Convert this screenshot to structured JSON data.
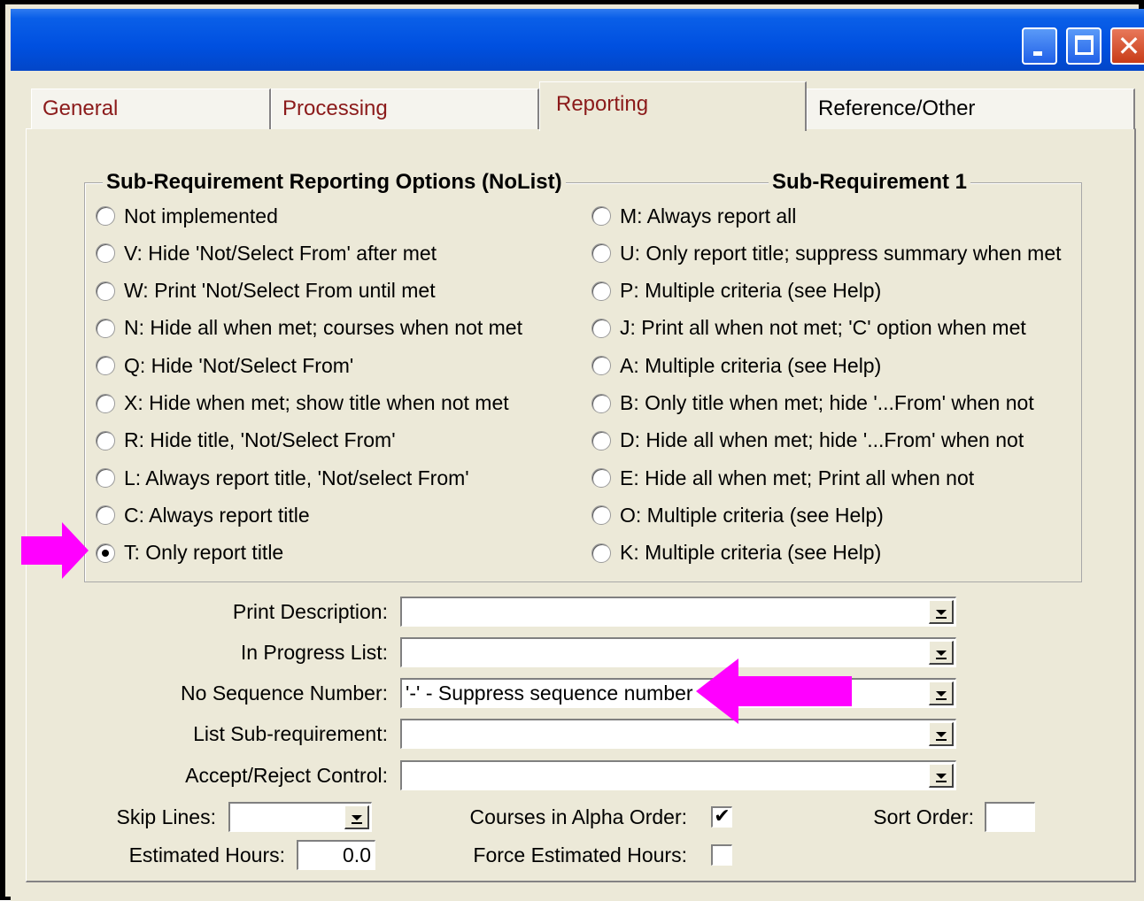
{
  "window": {
    "title": ""
  },
  "tabs": [
    {
      "label": "General",
      "active": false
    },
    {
      "label": "Processing",
      "active": false
    },
    {
      "label": "Reporting",
      "active": true
    },
    {
      "label": "Reference/Other",
      "active": false
    }
  ],
  "group": {
    "title": "Sub-Requirement Reporting Options (NoList)",
    "subtitle": "Sub-Requirement 1",
    "left_options": [
      {
        "label": "Not implemented",
        "checked": false
      },
      {
        "label": "V: Hide 'Not/Select From' after met",
        "checked": false
      },
      {
        "label": "W: Print 'Not/Select From until met",
        "checked": false
      },
      {
        "label": "N: Hide all when met; courses when not met",
        "checked": false
      },
      {
        "label": "Q: Hide 'Not/Select From'",
        "checked": false
      },
      {
        "label": "X: Hide when met; show title when not met",
        "checked": false
      },
      {
        "label": "R: Hide title, 'Not/Select From'",
        "checked": false
      },
      {
        "label": "L: Always report title, 'Not/select From'",
        "checked": false
      },
      {
        "label": "C: Always report title",
        "checked": false
      },
      {
        "label": "T: Only report title",
        "checked": true
      }
    ],
    "right_options": [
      {
        "label": "M: Always report all",
        "checked": false
      },
      {
        "label": "U: Only report title; suppress summary when met",
        "checked": false
      },
      {
        "label": "P: Multiple criteria (see Help)",
        "checked": false
      },
      {
        "label": "J: Print all when not met; 'C' option when met",
        "checked": false
      },
      {
        "label": "A: Multiple criteria (see Help)",
        "checked": false
      },
      {
        "label": "B: Only title when met; hide '...From' when not",
        "checked": false
      },
      {
        "label": "D: Hide all when met; hide '...From' when not",
        "checked": false
      },
      {
        "label": "E: Hide all when met; Print all when not",
        "checked": false
      },
      {
        "label": "O: Multiple criteria (see Help)",
        "checked": false
      },
      {
        "label": "K: Multiple criteria (see Help)",
        "checked": false
      }
    ]
  },
  "fields": {
    "print_description": {
      "label": "Print Description:",
      "value": ""
    },
    "in_progress_list": {
      "label": "In Progress List:",
      "value": ""
    },
    "no_sequence_number": {
      "label": "No Sequence Number:",
      "value": "'-' - Suppress sequence number"
    },
    "list_subrequirement": {
      "label": "List Sub-requirement:",
      "value": ""
    },
    "accept_reject_control": {
      "label": "Accept/Reject Control:",
      "value": ""
    },
    "skip_lines": {
      "label": "Skip Lines:",
      "value": ""
    },
    "estimated_hours": {
      "label": "Estimated Hours:",
      "value": "0.0"
    },
    "courses_alpha": {
      "label": "Courses in Alpha Order:",
      "checked": true,
      "mark": "✔"
    },
    "force_estimated": {
      "label": "Force Estimated Hours:",
      "checked": false,
      "mark": ""
    },
    "sort_order": {
      "label": "Sort Order:",
      "value": ""
    }
  },
  "colors": {
    "annotation_arrow": "#ff00ff",
    "tab_text": "#8b1a1a",
    "titlebar": "#0050e0"
  },
  "icons": {
    "minimize": "minimize-icon",
    "maximize": "maximize-icon",
    "close": "close-icon",
    "close_glyph": "✕"
  }
}
